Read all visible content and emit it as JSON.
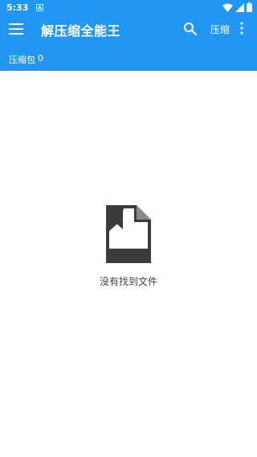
{
  "status_bar": {
    "time": "5:33"
  },
  "app_bar": {
    "title": "解压缩全能王",
    "compress_label": "压缩"
  },
  "sub_bar": {
    "label": "压缩包",
    "count": "0"
  },
  "empty_state": {
    "message": "没有找到文件"
  },
  "icons": {
    "menu": "menu-icon",
    "search": "search-icon",
    "more": "more-vert-icon",
    "empty": "document-bookmark-icon",
    "wifi": "wifi-icon",
    "signal": "signal-icon",
    "battery": "battery-icon"
  },
  "colors": {
    "primary": "#2196F3",
    "empty_icon": "#3b3b3b",
    "empty_text": "#444444"
  }
}
